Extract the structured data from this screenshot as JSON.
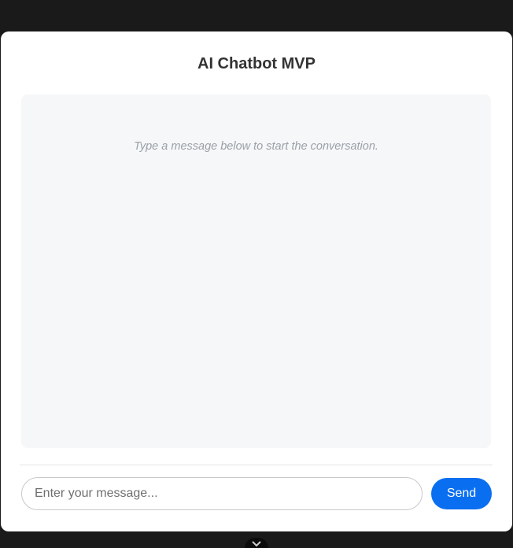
{
  "app": {
    "title": "AI Chatbot MVP"
  },
  "chat": {
    "empty_message": "Type a message below to start the conversation."
  },
  "composer": {
    "input_value": "",
    "input_placeholder": "Enter your message...",
    "send_label": "Send"
  },
  "icons": {
    "bottom_handle": "chevron-down-icon"
  },
  "colors": {
    "page_background": "#1a1a1a",
    "card_background": "#ffffff",
    "messages_background": "#f6f7f9",
    "accent": "#0a6ef0",
    "title_text": "#333333",
    "hint_text": "#9aa0a6"
  }
}
